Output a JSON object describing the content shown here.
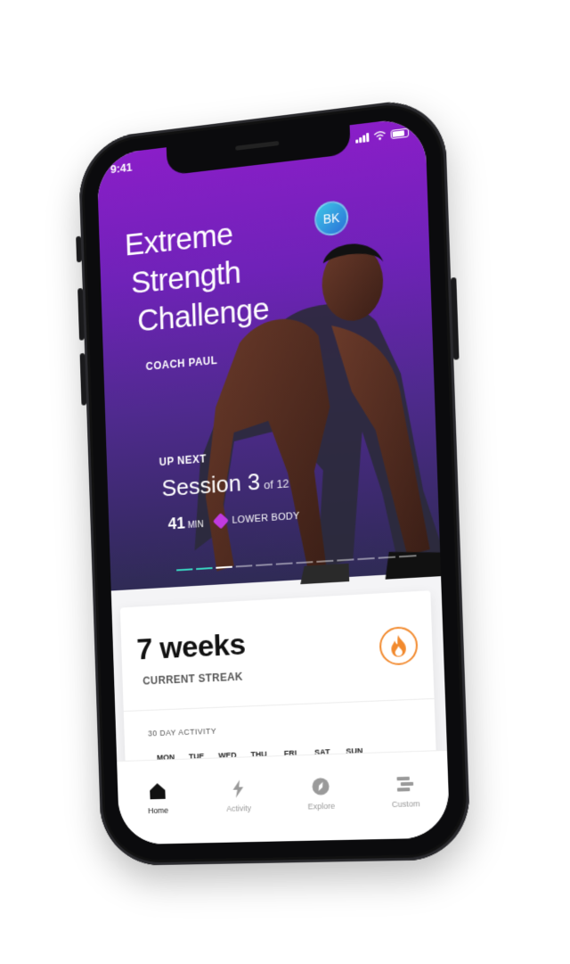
{
  "status": {
    "time": "9:41"
  },
  "hero": {
    "title_line1": "Extreme",
    "title_line2": "Strength",
    "title_line3": "Challenge",
    "coach": "COACH PAUL",
    "avatar_initials": "BK",
    "up_next_label": "UP NEXT",
    "session_title": "Session 3",
    "session_of": "of 12",
    "duration_value": "41",
    "duration_unit": "MIN",
    "focus": "LOWER BODY",
    "progress_total": 12,
    "progress_done": 2,
    "progress_current": 3
  },
  "streak_card": {
    "weeks": "7 weeks",
    "label": "CURRENT STREAK",
    "activity_label": "30 DAY ACTIVITY",
    "days": [
      "MON",
      "TUE",
      "WED",
      "THU",
      "FRI",
      "SAT",
      "SUN"
    ]
  },
  "tabs": [
    {
      "label": "Home",
      "icon": "home-icon",
      "active": true
    },
    {
      "label": "Activity",
      "icon": "bolt-icon",
      "active": false
    },
    {
      "label": "Explore",
      "icon": "compass-icon",
      "active": false
    },
    {
      "label": "Custom",
      "icon": "list-icon",
      "active": false
    }
  ],
  "colors": {
    "hero_top": "#8a1ec8",
    "hero_bottom": "#2f2b55",
    "accent_teal": "#39d3c0",
    "flame": "#f28a2e",
    "avatar": "#2a6fd8"
  }
}
